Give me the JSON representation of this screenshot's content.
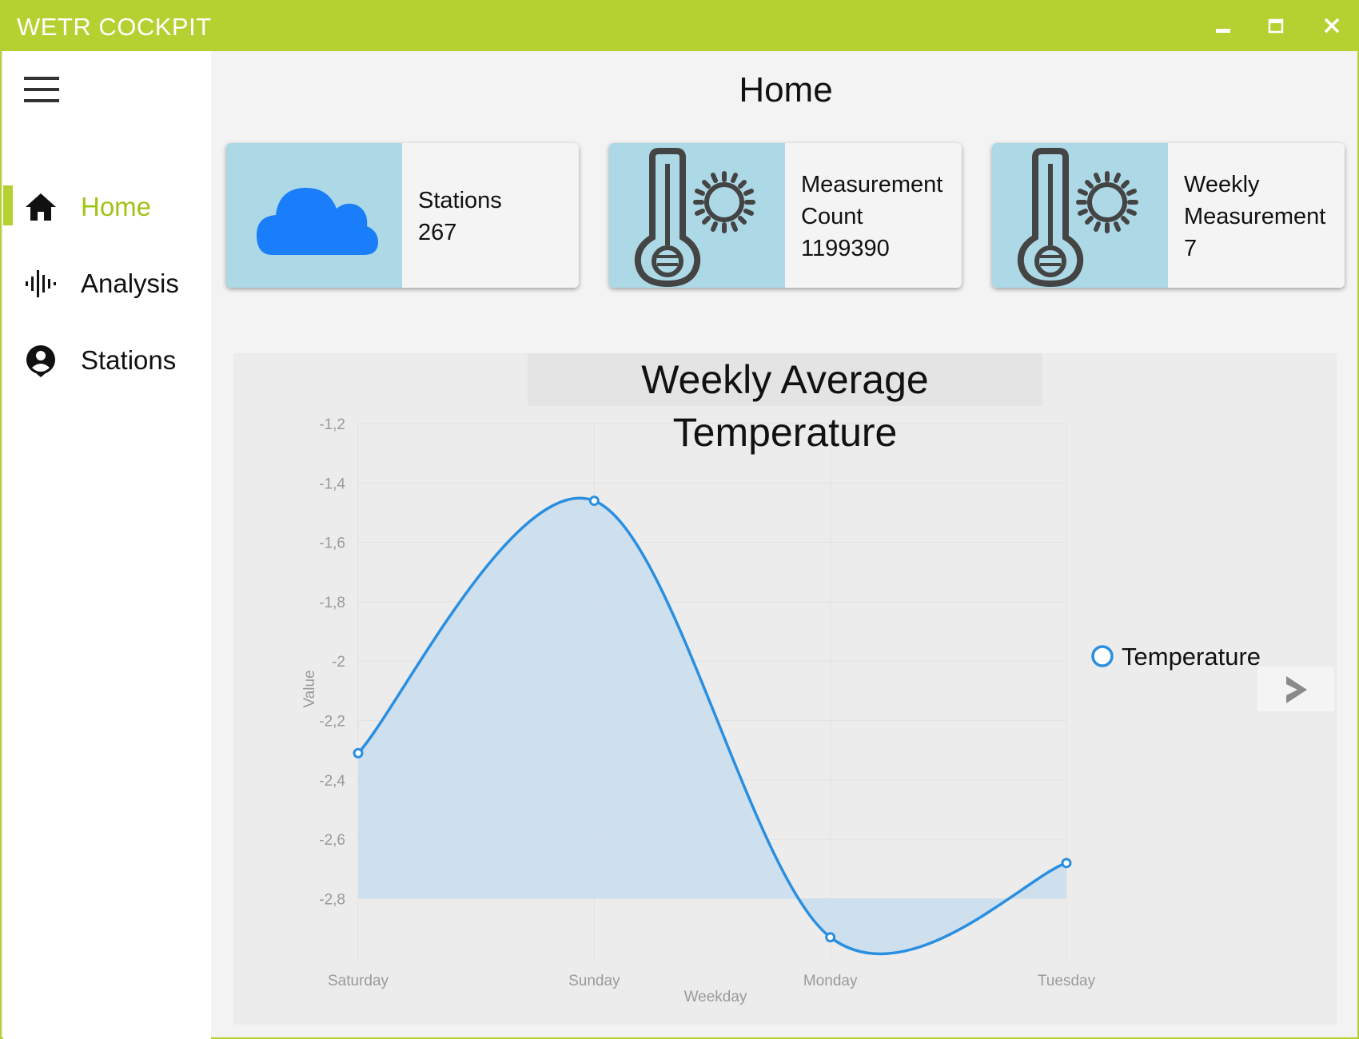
{
  "window": {
    "title": "WETR COCKPIT",
    "accent_color": "#b5d131",
    "controls": [
      "minimize-icon",
      "maximize-icon",
      "close-icon"
    ]
  },
  "sidebar": {
    "menu_icon": "hamburger-menu-icon",
    "items": [
      {
        "label": "Home",
        "icon": "home-icon",
        "active": true
      },
      {
        "label": "Analysis",
        "icon": "waveform-icon",
        "active": false
      },
      {
        "label": "Stations",
        "icon": "person-pin-icon",
        "active": false
      }
    ],
    "active_color": "#9fc416"
  },
  "page": {
    "title": "Home"
  },
  "cards": [
    {
      "icon": "cloud-icon",
      "line1": "Stations",
      "line2": "267"
    },
    {
      "icon": "thermometer-sun-icon",
      "line1": "Measurement",
      "line2": "Count",
      "line3": "1199390"
    },
    {
      "icon": "thermometer-sun-icon",
      "line1": "Weekly",
      "line2": "Measurement",
      "line3": "7"
    }
  ],
  "chart_data": {
    "type": "area",
    "title": "Weekly Average Temperature",
    "xlabel": "Weekday",
    "ylabel": "Value",
    "categories": [
      "Saturday",
      "Sunday",
      "Monday",
      "Tuesday"
    ],
    "series": [
      {
        "name": "Temperature",
        "values": [
          -2.31,
          -1.46,
          -2.93,
          -2.68
        ],
        "color": "#2a8fe0"
      }
    ],
    "y_ticks": [
      "-1,2",
      "-1,4",
      "-1,6",
      "-1,8",
      "-2",
      "-2,2",
      "-2,4",
      "-2,6",
      "-2,8"
    ],
    "ylim": [
      -3.15,
      -1.2
    ],
    "area_baseline": -2.8,
    "smooth": true,
    "legend_position": "right",
    "grid": true
  },
  "chart_nav": {
    "icon": "chevron-right-icon"
  }
}
